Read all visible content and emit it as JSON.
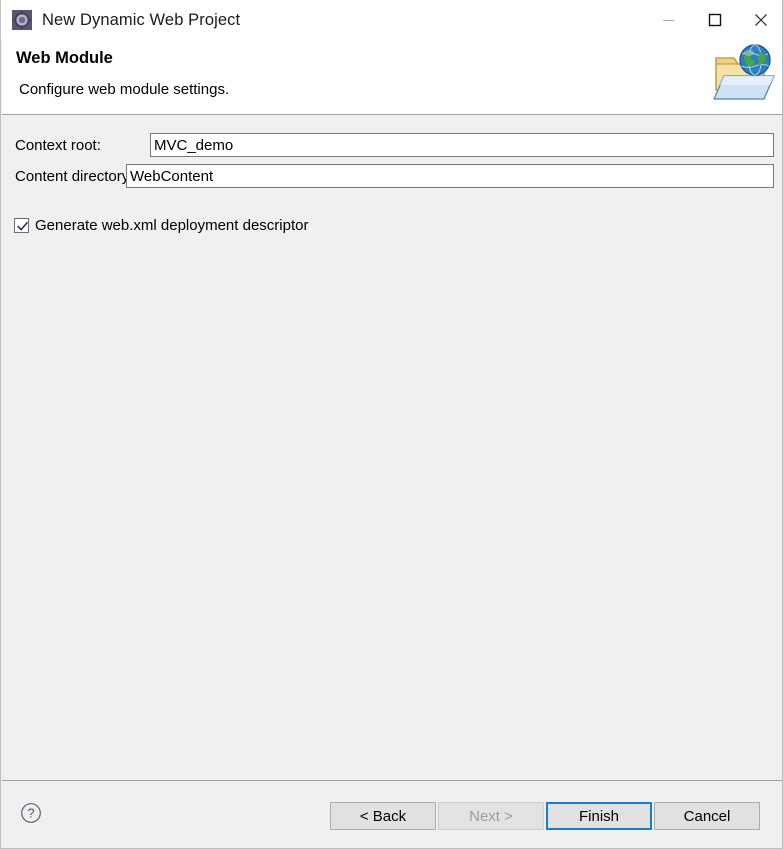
{
  "window": {
    "title": "New Dynamic Web Project",
    "icon": "eclipse-project-icon",
    "controls": {
      "minimize": "minimize-icon",
      "maximize": "maximize-icon",
      "close": "close-icon"
    }
  },
  "header": {
    "title": "Web Module",
    "description": "Configure web module settings.",
    "banner_icon": "web-folder-globe-icon"
  },
  "form": {
    "context_root": {
      "label": "Context root:",
      "value": "MVC_demo",
      "placeholder": ""
    },
    "content_directory": {
      "label": "Content directory:",
      "value": "WebContent",
      "placeholder": ""
    },
    "generate_webxml": {
      "label": "Generate web.xml deployment descriptor",
      "checked": true
    }
  },
  "footer": {
    "help_icon": "help-question-icon",
    "buttons": [
      {
        "label": "< Back",
        "state": "enabled"
      },
      {
        "label": "Next >",
        "state": "disabled"
      },
      {
        "label": "Finish",
        "state": "default"
      },
      {
        "label": "Cancel",
        "state": "enabled"
      }
    ]
  },
  "colors": {
    "dialog_background": "#f0f0f0",
    "header_background": "#ffffff",
    "accent_focus": "#1c7ccc",
    "separator": "#a0a0a0",
    "disabled_text": "#9c9c9c"
  }
}
